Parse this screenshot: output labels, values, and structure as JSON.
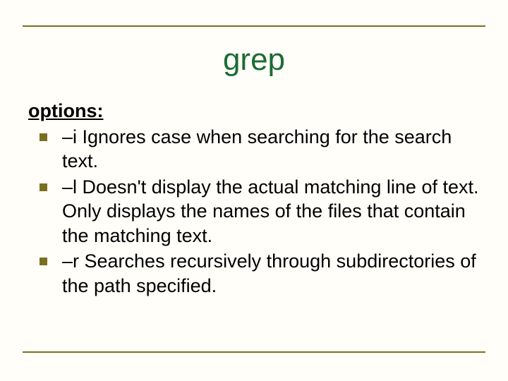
{
  "title": "grep",
  "section_heading": "options:",
  "options": [
    {
      "text": " –i   Ignores case when searching for the search text."
    },
    {
      "text": "–l Doesn't display the actual matching line of text. Only displays the names  of the files that contain the matching text."
    },
    {
      "text": " –r   Searches recursively through subdirectories of the path specified."
    }
  ],
  "colors": {
    "rule": "#7a6f1f",
    "title": "#1b6b35",
    "background": "#fffef9"
  }
}
